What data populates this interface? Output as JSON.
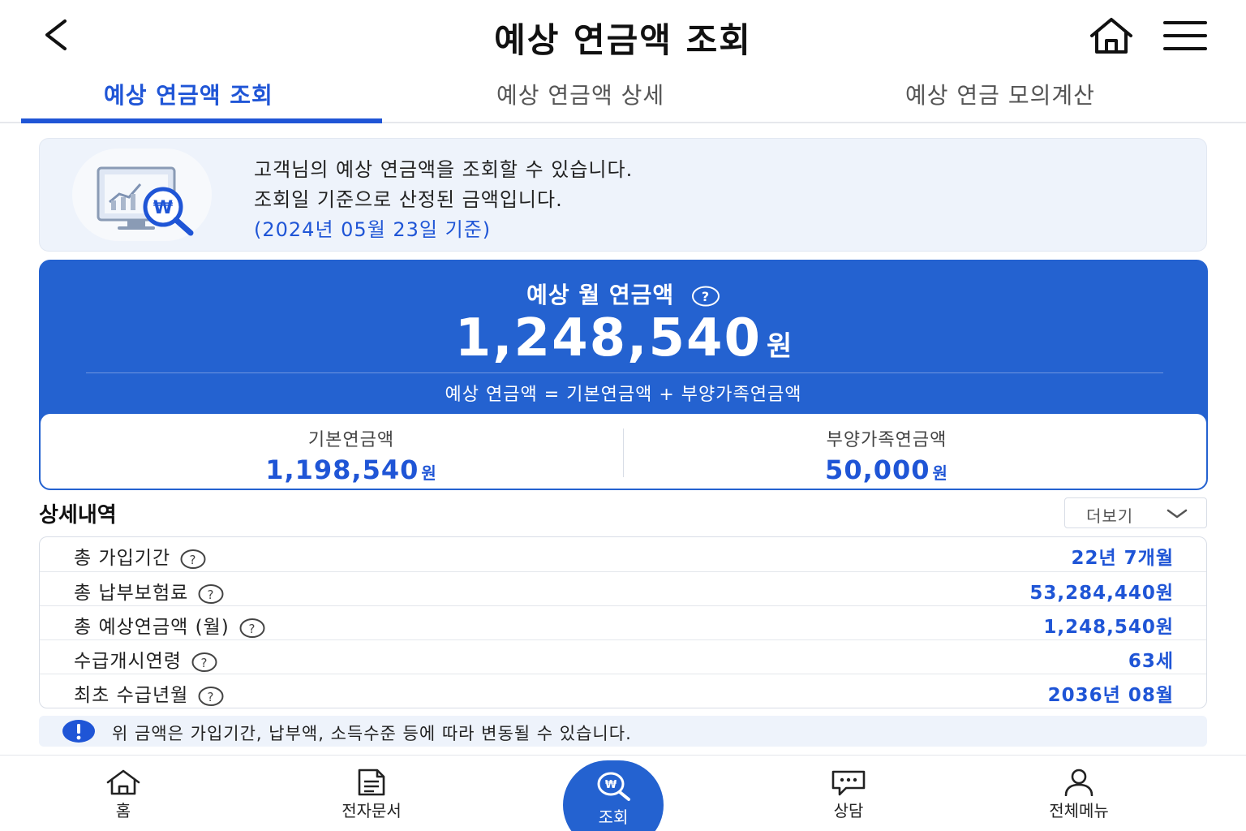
{
  "header": {
    "title": "예상 연금액 조회",
    "back_icon": "chevron-left-icon",
    "home_icon": "home-icon",
    "menu_icon": "hamburger-menu-icon"
  },
  "tabs": [
    {
      "label": "예상 연금액 조회",
      "active": true
    },
    {
      "label": "예상 연금액 상세",
      "active": false
    },
    {
      "label": "예상 연금 모의계산",
      "active": false
    }
  ],
  "info": {
    "line1": "고객님의 예상 연금액을 조회할 수 있습니다.",
    "line2": "조회일 기준으로 산정된 금액입니다.",
    "date_note": "(2024년 05월 23일 기준)",
    "icon": "monitor-won-search-icon"
  },
  "pension": {
    "label": "예상 월 연금액",
    "amount": "1,248,540",
    "unit": "원",
    "formula": "예상 연금액 = 기본연금액 + 부양가족연금액",
    "basic_label": "기본연금액",
    "basic_value": "1,198,540",
    "family_label": "부양가족연금액",
    "family_value": "50,000"
  },
  "details": {
    "title": "상세내역",
    "more_label": "더보기",
    "rows": [
      {
        "label": "총 가입기간",
        "value": "22년 7개월"
      },
      {
        "label": "총 납부보험료",
        "value": "53,284,440원"
      },
      {
        "label": "총 예상연금액 (월)",
        "value": "1,248,540원"
      },
      {
        "label": "수급개시연령",
        "value": "63세"
      },
      {
        "label": "최초 수급년월",
        "value": "2036년 08월"
      }
    ]
  },
  "notice": {
    "text": "위 금액은 가입기간, 납부액, 소득수준 등에 따라 변동될 수 있습니다."
  },
  "nav": {
    "items": [
      {
        "label": "홈",
        "icon": "home-icon"
      },
      {
        "label": "전자문서",
        "icon": "document-icon"
      },
      {
        "label": "조회",
        "icon": "search-icon",
        "active": true
      },
      {
        "label": "상담",
        "icon": "chat-icon"
      },
      {
        "label": "전체메뉴",
        "icon": "user-icon"
      }
    ]
  },
  "colors": {
    "accent": "#1f55d6",
    "card": "#2462d0",
    "info_bg": "#eef3fb"
  }
}
